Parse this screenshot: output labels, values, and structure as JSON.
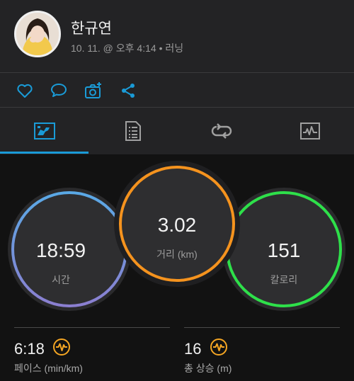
{
  "profile": {
    "name": "한규연",
    "date": "10. 11. @ 오후 4:14",
    "separator": "•",
    "activity_type": "러닝"
  },
  "actions": [
    "like-icon",
    "comment-icon",
    "add-photo-icon",
    "share-icon"
  ],
  "tabs": [
    {
      "icon": "overview-icon",
      "selected": true
    },
    {
      "icon": "details-icon",
      "selected": false
    },
    {
      "icon": "laps-icon",
      "selected": false
    },
    {
      "icon": "charts-icon",
      "selected": false
    }
  ],
  "rings": {
    "time": {
      "value": "18:59",
      "label": "시간"
    },
    "distance": {
      "value": "3.02",
      "label": "거리 (km)"
    },
    "calories": {
      "value": "151",
      "label": "칼로리"
    }
  },
  "bottom_stats": {
    "pace": {
      "value": "6:18",
      "label": "페이스 (min/km)",
      "icon": "pulse-icon"
    },
    "elevation": {
      "value": "16",
      "label": "총 상승 (m)",
      "icon": "pulse-icon"
    }
  },
  "colors": {
    "accent": "#1a9bd7",
    "time_ring_top": "#5aa9e6",
    "time_ring_bottom": "#8b7fd0",
    "distance_ring": "#f5931e",
    "calories_ring": "#2ee04a",
    "pulse_icon": "#f5a623"
  }
}
